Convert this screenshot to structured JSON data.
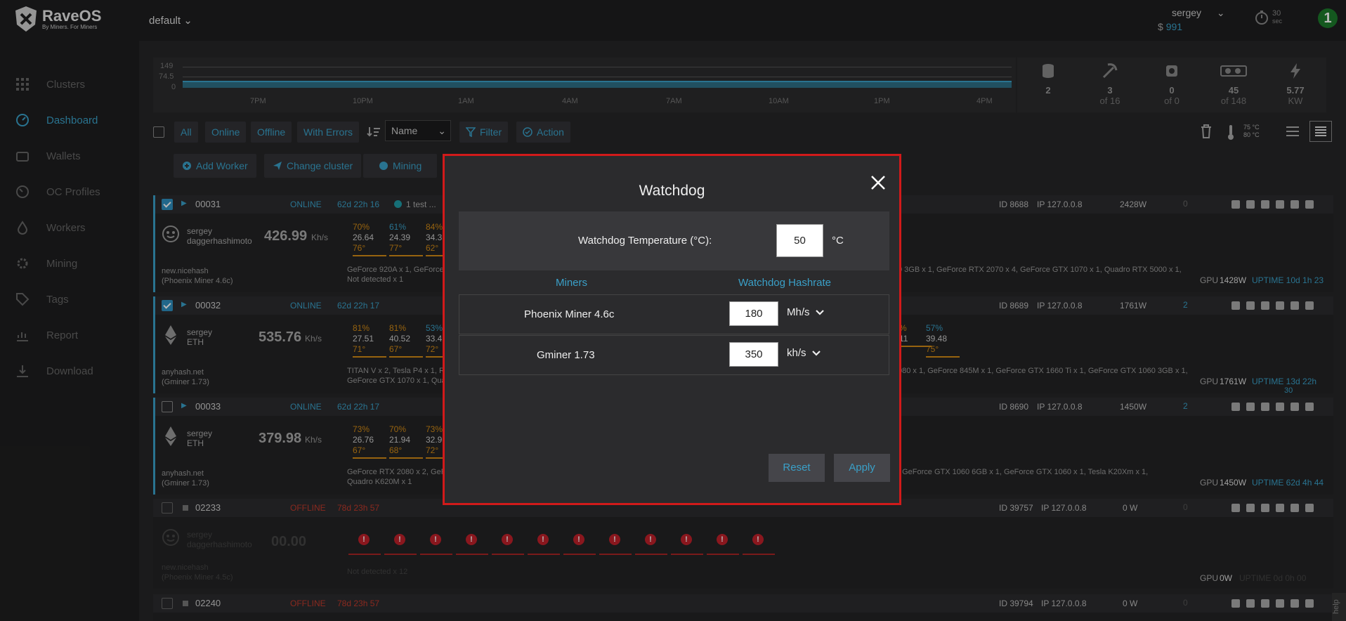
{
  "header": {
    "logo_title": "RaveOS",
    "logo_tagline": "By Miners. For Miners",
    "cluster": "default",
    "user": "sergey",
    "currency": "$",
    "balance": "991",
    "refresh_value": "30",
    "refresh_unit": "sec",
    "notifications": "1"
  },
  "sidebar": {
    "items": [
      {
        "label": "Clusters",
        "icon": "grid-icon"
      },
      {
        "label": "Dashboard",
        "icon": "dashboard-icon",
        "active": true
      },
      {
        "label": "Wallets",
        "icon": "wallet-icon"
      },
      {
        "label": "OC Profiles",
        "icon": "gauge-icon"
      },
      {
        "label": "Workers",
        "icon": "drop-icon"
      },
      {
        "label": "Mining",
        "icon": "settings-icon"
      },
      {
        "label": "Tags",
        "icon": "tag-icon"
      },
      {
        "label": "Report",
        "icon": "report-icon"
      },
      {
        "label": "Download",
        "icon": "download-icon"
      }
    ]
  },
  "chart": {
    "y_ticks": [
      "149",
      "74.5",
      "0"
    ],
    "x_ticks": [
      "7PM",
      "10PM",
      "1AM",
      "4AM",
      "7AM",
      "10AM",
      "1PM",
      "4PM"
    ]
  },
  "stats": [
    {
      "icon": "database-icon",
      "value": "2",
      "sub": ""
    },
    {
      "icon": "pickaxe-icon",
      "value": "3",
      "sub": "of 16"
    },
    {
      "icon": "chip-icon",
      "value": "0",
      "sub": "of 0"
    },
    {
      "icon": "gpu-icon",
      "value": "45",
      "sub": "of 148"
    },
    {
      "icon": "lightning-icon",
      "value": "5.77",
      "sub": "KW"
    }
  ],
  "toolbar": {
    "filters": [
      "All",
      "Online",
      "Offline",
      "With Errors"
    ],
    "sort_value": "Name",
    "filter_label": "Filter",
    "action_label": "Action",
    "temp_high": "75 °C",
    "temp_low": "80 °C",
    "add_worker": "Add Worker",
    "change_cluster": "Change cluster",
    "mining": "Mining"
  },
  "workers": [
    {
      "id": "00031",
      "status": "ONLINE",
      "uptime_short": "62d 22h 16",
      "note": "1 test ...",
      "owner": "sergey",
      "algo": "daggerhashimoto",
      "rate": "426.99",
      "rate_unit": "Kh/s",
      "pool": "new.nicehash",
      "miner": "(Phoenix Miner 4.6c)",
      "gpus": "GeForce 920A x 1, GeForce",
      "gpus2": "Not detected x 1",
      "gpus_right": "0 3GB x 1, GeForce RTX 2070 x 4, GeForce GTX 1070 x 1, Quadro RTX 5000 x 1,",
      "wid": "ID 8688",
      "ip": "IP 127.0.0.8",
      "power": "2428W",
      "alerts": "0",
      "gpu_power": "1428W",
      "uptime": "UPTIME 10d 1h 23",
      "cols": [
        [
          "70%",
          "26.64",
          "76°"
        ],
        [
          "61%",
          "24.39",
          "77°"
        ],
        [
          "84%",
          "34.3",
          "62°"
        ]
      ]
    },
    {
      "id": "00032",
      "status": "ONLINE",
      "uptime_short": "62d 22h 17",
      "owner": "sergey",
      "algo": "ETH",
      "rate": "535.76",
      "rate_unit": "Kh/s",
      "pool": "anyhash.net",
      "miner": "(Gminer 1.73)",
      "gpus": "TITAN V x 2, Tesla P4 x 1, Ra",
      "gpus2": "GeForce GTX 1070 x 1, Qua",
      "gpus_right": "080 x 1, GeForce 845M x 1, GeForce GTX 1660 Ti x 1, GeForce GTX 1060 3GB x 1,",
      "wid": "ID 8689",
      "ip": "IP 127.0.0.8",
      "power": "1761W",
      "alerts": "2",
      "gpu_power": "1761W",
      "uptime": "UPTIME 13d 22h",
      "uptime2": "30",
      "cols": [
        [
          "81%",
          "27.51",
          "71°"
        ],
        [
          "81%",
          "40.52",
          "67°"
        ],
        [
          "53%",
          "33.4",
          "72°"
        ]
      ],
      "cols_right": [
        [
          "%",
          "11",
          ""
        ],
        [
          "57%",
          "39.48",
          "75°"
        ]
      ]
    },
    {
      "id": "00033",
      "status": "ONLINE",
      "uptime_short": "62d 22h 17",
      "owner": "sergey",
      "algo": "ETH",
      "rate": "379.98",
      "rate_unit": "Kh/s",
      "pool": "anyhash.net",
      "miner": "(Gminer 1.73)",
      "gpus": "GeForce RTX 2080 x 2, GeFo",
      "gpus2": "Quadro K620M x 1",
      "gpus_right": ", GeForce GTX 1060 6GB x 1, GeForce GTX 1060 x 1, Tesla K20Xm x 1,",
      "wid": "ID 8690",
      "ip": "IP 127.0.0.8",
      "power": "1450W",
      "alerts": "2",
      "gpu_power": "1450W",
      "uptime": "UPTIME 62d 4h 44",
      "cols": [
        [
          "73%",
          "26.76",
          "67°"
        ],
        [
          "70%",
          "21.94",
          "68°"
        ],
        [
          "73%",
          "32.9",
          "72°"
        ]
      ]
    },
    {
      "id": "02233",
      "status": "OFFLINE",
      "uptime_short": "78d 23h 57",
      "owner": "sergey",
      "algo": "daggerhashimoto",
      "rate": "00.00",
      "pool": "new.nicehash",
      "miner": "(Phoenix Miner 4.5c)",
      "gpus": "Not detected x 12",
      "wid": "ID 39757",
      "ip": "IP 127.0.0.8",
      "power": "0 W",
      "alerts": "0",
      "gpu_power": "0W",
      "uptime": "UPTIME 0d 0h 00",
      "error_mark": "!"
    },
    {
      "id": "02240",
      "status": "OFFLINE",
      "uptime_short": "78d 23h 57",
      "wid": "ID 39794",
      "ip": "IP 127.0.0.8",
      "power": "0 W",
      "alerts": "0"
    }
  ],
  "labels": {
    "gpu": "GPU"
  },
  "modal": {
    "title": "Watchdog",
    "temp_label": "Watchdog Temperature (°C):",
    "temp_value": "50",
    "temp_unit": "°C",
    "col_miners": "Miners",
    "col_hashrate": "Watchdog Hashrate",
    "rows": [
      {
        "miner": "Phoenix Miner 4.6c",
        "value": "180",
        "unit": "Mh/s"
      },
      {
        "miner": "Gminer 1.73",
        "value": "350",
        "unit": "kh/s"
      }
    ],
    "reset": "Reset",
    "apply": "Apply"
  },
  "help": "help"
}
